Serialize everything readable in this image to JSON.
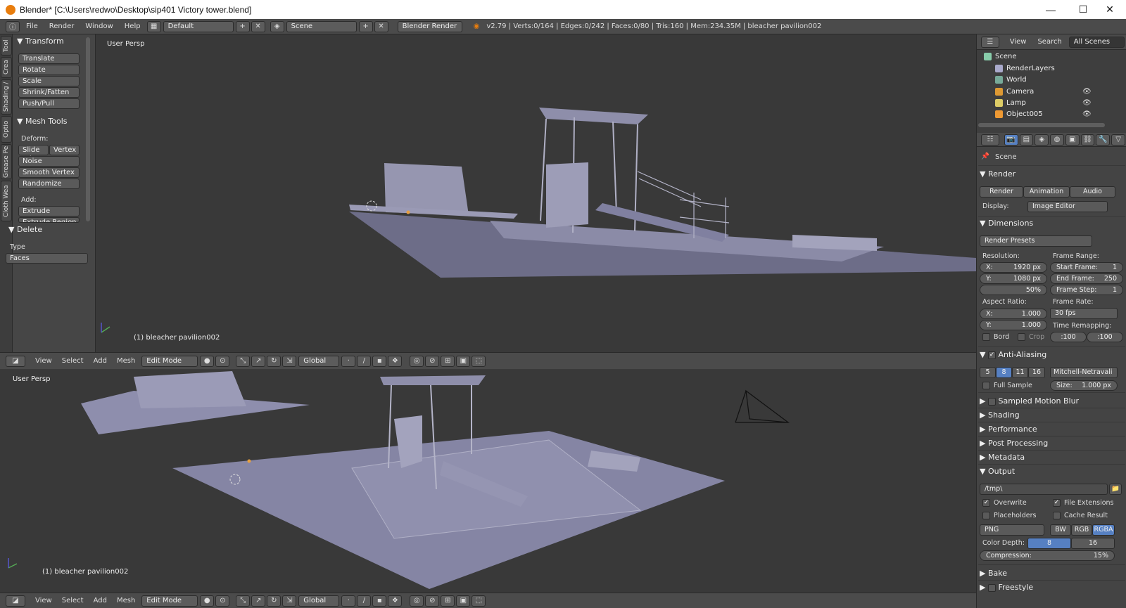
{
  "window": {
    "title": "Blender* [C:\\Users\\redwo\\Desktop\\sip401 Victory tower.blend]",
    "minimize": "—",
    "maximize": "☐",
    "close": "✕"
  },
  "topbar": {
    "menus": [
      "File",
      "Render",
      "Window",
      "Help"
    ],
    "layout": "Default",
    "scene": "Scene",
    "engine": "Blender Render",
    "status": "v2.79 | Verts:0/164 | Edges:0/242 | Faces:0/80 | Tris:160 | Mem:234.35M | bleacher pavilion002"
  },
  "tabs": [
    "Tool",
    "Crea",
    "Shading /",
    "Optio",
    "Grease Pe",
    "Cloth Wea"
  ],
  "toolshelf": {
    "transform_header": "Transform",
    "transform_buttons": [
      "Translate",
      "Rotate",
      "Scale",
      "Shrink/Fatten",
      "Push/Pull"
    ],
    "mesh_tools_header": "Mesh Tools",
    "deform_label": "Deform:",
    "slide_edge": "Slide Ed",
    "vertex": "Vertex",
    "deform_buttons": [
      "Noise",
      "Smooth Vertex",
      "Randomize"
    ],
    "add_label": "Add:",
    "extrude": "Extrude",
    "extrude_region": "Extrude Region",
    "delete_header": "Delete",
    "type_label": "Type",
    "type_value": "Faces"
  },
  "viewport_top": {
    "label": "User Persp",
    "object": "(1) bleacher pavilion002"
  },
  "viewport_bottom": {
    "label": "User Persp",
    "object": "(1) bleacher pavilion002"
  },
  "view3d_header": {
    "menus": [
      "View",
      "Select",
      "Add",
      "Mesh"
    ],
    "mode": "Edit Mode",
    "orientation": "Global"
  },
  "outliner": {
    "view": "View",
    "search": "Search",
    "all_scenes": "All Scenes",
    "items": [
      "Scene",
      "RenderLayers",
      "World",
      "Camera",
      "Lamp",
      "Object005"
    ]
  },
  "properties": {
    "context": "Scene",
    "render_header": "Render",
    "render_btn": "Render",
    "animation_btn": "Animation",
    "audio_btn": "Audio",
    "display_label": "Display:",
    "display_value": "Image Editor",
    "dimensions_header": "Dimensions",
    "presets": "Render Presets",
    "resolution_label": "Resolution:",
    "frame_range_label": "Frame Range:",
    "res_x": "1920 px",
    "res_y": "1080 px",
    "res_pct": "50%",
    "start_frame": "1",
    "end_frame": "250",
    "frame_step": "1",
    "aspect_label": "Aspect Ratio:",
    "frame_rate_label": "Frame Rate:",
    "aspect_x": "1.000",
    "aspect_y": "1.000",
    "fps": "30 fps",
    "time_remap_label": "Time Remapping:",
    "remap_old": "100",
    "remap_new": "100",
    "bord": "Bord",
    "crop": "Crop",
    "aa_header": "Anti-Aliasing",
    "aa_samples": [
      "5",
      "8",
      "11",
      "16"
    ],
    "aa_filter": "Mitchell-Netravali",
    "full_sample": "Full Sample",
    "size_label": "Size:",
    "size_value": "1.000 px",
    "collapsed": [
      "Sampled Motion Blur",
      "Shading",
      "Performance",
      "Post Processing",
      "Metadata"
    ],
    "output_header": "Output",
    "output_path": "/tmp\\",
    "overwrite": "Overwrite",
    "file_ext": "File Extensions",
    "placeholders": "Placeholders",
    "cache_result": "Cache Result",
    "format": "PNG",
    "bw": "BW",
    "rgb": "RGB",
    "rgba": "RGBA",
    "color_depth_label": "Color Depth:",
    "depth8": "8",
    "depth16": "16",
    "compression_label": "Compression:",
    "compression_value": "15%",
    "bake": "Bake",
    "freestyle": "Freestyle"
  },
  "colors": {
    "accent": "#5680c2",
    "viewport": "#393939",
    "panel": "#444444",
    "logo": "#e87d0d"
  }
}
